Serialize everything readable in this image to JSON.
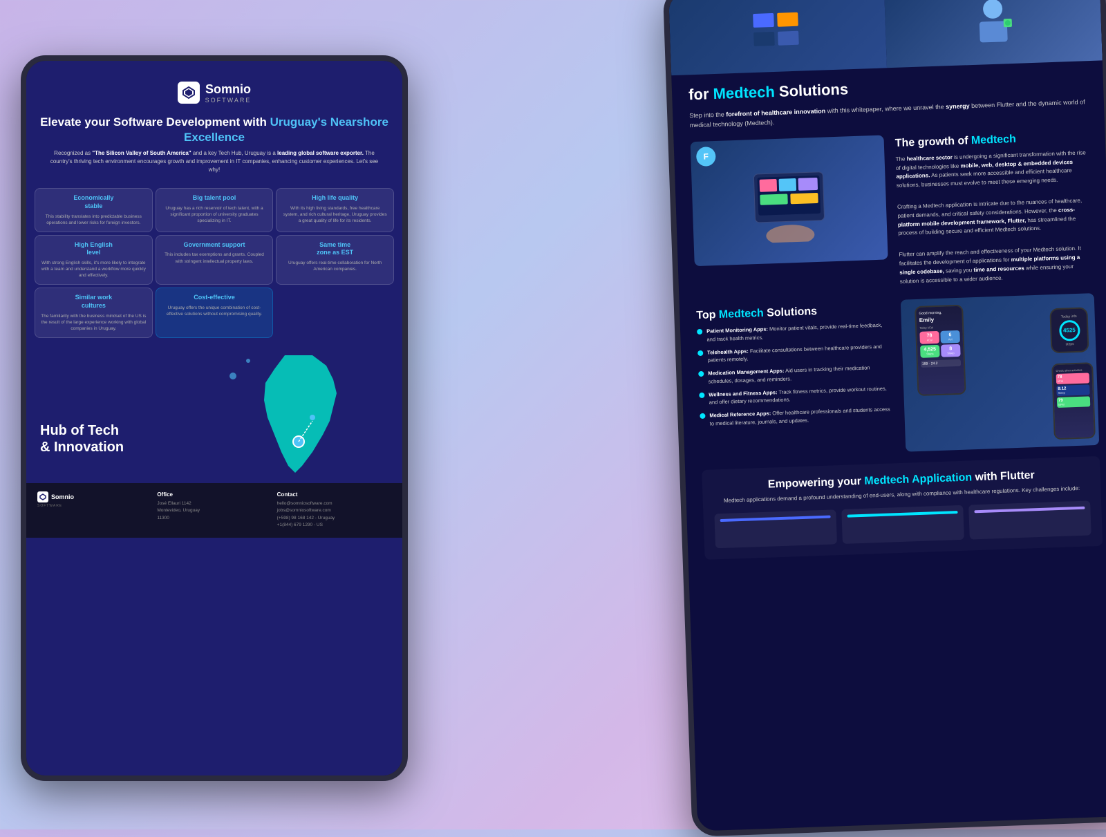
{
  "background": {
    "gradient": "linear-gradient(135deg, #c8b4e8, #b8c8f0, #d4b8e8)"
  },
  "tablet_left": {
    "logo": {
      "name": "Somnio",
      "sub": "SOFTWARE"
    },
    "main_title": "Elevate your Software Development with Uruguay's Nearshore Excellence",
    "subtitle": "Recognized as \"The Silicon Valley of South America\" and a key Tech Hub, Uruguay is a leading global software exporter. The country's thriving tech environment encourages growth and improvement in IT companies, enhancing customer experiences. Let's see why!",
    "features": [
      {
        "title": "Economically stable",
        "text": "This stability translates into predictable business operations and lower risks for foreign investors."
      },
      {
        "title": "Big talent pool",
        "text": "Uruguay has a rich reservoir of tech talent, with a significant proportion of university graduates specializing in IT."
      },
      {
        "title": "High life quality",
        "text": "With its high living standards, free healthcare system, and rich cultural heritage, Uruguay provides a great quality of life for its residents."
      },
      {
        "title": "High English level",
        "text": "With strong English skills, it's more likely to integrate with a team and understand a workflow more quickly and effectively."
      },
      {
        "title": "Government support",
        "text": "This includes tax exemptions and grants. Coupled with stringent intellectual property laws."
      },
      {
        "title": "Same time zone as EST",
        "text": "Uruguay offers real-time collaboration for North American companies."
      },
      {
        "title": "Similar work cultures",
        "text": "The familiarity with the business mindset of the US is the result of the large experience working with global companies in Uruguay."
      },
      {
        "title": "Cost-effective",
        "text": "Uruguay offers the unique combination of cost-effective solutions without compromising quality."
      }
    ],
    "hub_text": "Hub of Tech\n& Innovation",
    "footer": {
      "office_title": "Office",
      "office_address": "José Ellauri 1142\nMontevideo, Uruguay\n11300",
      "contact_title": "Contact",
      "contact_email": "hello@somniosoftware.com",
      "contact_jobs": "jobs@somniosoftware.com",
      "contact_phone_uy": "(+598) 98 168 142 - Uruguay",
      "contact_phone_us": "+1(844) 679 1290 - US"
    }
  },
  "tablet_right": {
    "main_title": "for Medtech Solutions",
    "intro": "Step into the forefront of healthcare innovation with this whitepaper, where we unravel the synergy between Flutter and the dynamic world of medical technology (Medtech).",
    "growth_section": {
      "title": "The growth of Medtech",
      "text": "The healthcare sector is undergoing a significant transformation with the rise of digital technologies like mobile, web, desktop & embedded devices applications. As patients seek more accessible and efficient healthcare solutions, businesses must evolve to meet these emerging needs.",
      "text2": "Crafting a Medtech application is intricate due to the nuances of healthcare, patient demands, and critical safety considerations. However, the cross-platform mobile development framework, Flutter, has streamlined the process of building secure and efficient Medtech solutions.",
      "text3": "Flutter can amplify the reach and effectiveness of your Medtech solution. It facilitates the development of applications for multiple platforms using a single codebase, saving you time and resources while ensuring your solution is accessible to a wider audience."
    },
    "top_medtech": {
      "title": "Top Medtech Solutions",
      "items": [
        {
          "label": "Patient Monitoring Apps:",
          "text": "Monitor patient vitals, provide real-time feedback, and track health metrics."
        },
        {
          "label": "Telehealth Apps:",
          "text": "Facilitate consultations between healthcare providers and patients remotely."
        },
        {
          "label": "Medication Management Apps:",
          "text": "Aid users in tracking their medication schedules, dosages, and reminders."
        },
        {
          "label": "Wellness and Fitness Apps:",
          "text": "Track fitness metrics, provide workout routines, and offer dietary recommendations."
        },
        {
          "label": "Medical Reference Apps:",
          "text": "Offer healthcare professionals and students access to medical literature, journals, and updates."
        }
      ]
    },
    "phone_mockup": {
      "greeting": "Good morning,",
      "name": "Emily",
      "stats": [
        {
          "value": "78",
          "label": "Today kCal"
        },
        {
          "value": "6",
          "label": "Activities"
        },
        {
          "value": "4,525",
          "label": "Steps"
        },
        {
          "value": "8",
          "label": "Hours sleep"
        }
      ],
      "watch_value": "4525",
      "second_phone_value": "8:12"
    },
    "empower_section": {
      "title": "Empowering your Medtech Application with Flutter",
      "text": "Medtech applications demand a profound understanding of end-users, along with compliance with healthcare regulations. Key challenges include:"
    }
  }
}
